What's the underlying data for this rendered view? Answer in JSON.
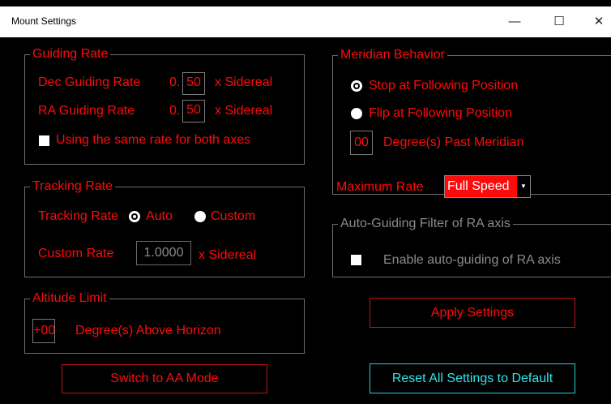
{
  "window": {
    "title": "Mount Settings",
    "minimize": "—",
    "maximize": "☐",
    "close": "✕"
  },
  "guiding": {
    "legend": "Guiding Rate",
    "dec_label": "Dec Guiding Rate",
    "dec_prefix": "0.",
    "dec_value": "50",
    "ra_label": "RA Guiding Rate",
    "ra_prefix": "0.",
    "ra_value": "50",
    "unit": "x Sidereal",
    "same_rate_label": "Using the same rate for both axes",
    "same_rate_checked": false
  },
  "tracking": {
    "legend": "Tracking Rate",
    "mode_label": "Tracking Rate",
    "auto_label": "Auto",
    "custom_label": "Custom",
    "selected": "auto",
    "custom_rate_label": "Custom Rate",
    "custom_rate_value": "1.0000",
    "unit": "x Sidereal"
  },
  "altitude": {
    "legend": "Altitude Limit",
    "value": "+00",
    "label": "Degree(s) Above Horizon"
  },
  "meridian": {
    "legend": "Meridian Behavior",
    "stop_label": "Stop at Following Position",
    "flip_label": "Flip at Following Position",
    "selected": "stop",
    "degrees_value": "00",
    "degrees_label": "Degree(s) Past Meridian"
  },
  "max_rate": {
    "label": "Maximum Rate",
    "value": "Full Speed"
  },
  "autoguide": {
    "legend": "Auto-Guiding Filter of RA axis",
    "enable_label": "Enable auto-guiding of RA axis",
    "checked": false
  },
  "buttons": {
    "switch_aa": "Switch to AA Mode",
    "apply": "Apply Settings",
    "reset": "Reset All Settings to Default"
  },
  "colors": {
    "accent": "#ff0a0a",
    "cyan": "#30e6ea",
    "border": "#6e6e6e",
    "disabled": "#8a8a8a"
  }
}
